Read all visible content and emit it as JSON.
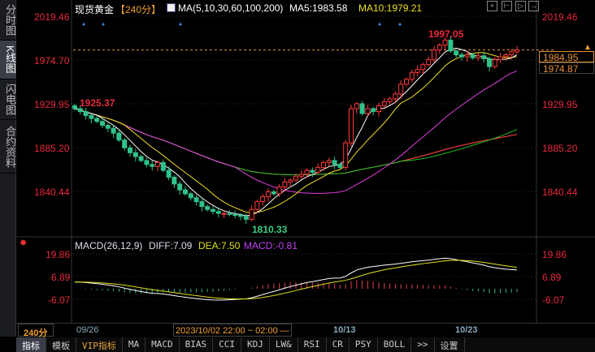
{
  "sidebar": {
    "items": [
      {
        "label": "分时图"
      },
      {
        "label": "K线图"
      },
      {
        "label": "闪电图"
      },
      {
        "label": "合约资料"
      }
    ]
  },
  "header": {
    "symbol": "现货黄金",
    "period": "【240分】",
    "ma_label": "MA(5,10,30,60,100,200)",
    "ma5": "MA5:1983.58",
    "ma10": "MA10:1979.21",
    "icon": "ma-chart-icon"
  },
  "toolbar_icons": [
    "crosshair-icon",
    "zoom-in-icon",
    "zoom-out-icon",
    "move-right-icon"
  ],
  "price_axis": {
    "left": [
      "2019.46",
      "1974.70",
      "1929.95",
      "1885.20",
      "1840.44"
    ],
    "right": [
      "2019.46",
      "1974.70",
      "1929.95",
      "1885.20",
      "1840.44"
    ]
  },
  "annotations": {
    "high": "1997.05",
    "start": "1925.37",
    "low": "1810.33"
  },
  "price_tags": {
    "last": "1984.95",
    "ma": "1974.87"
  },
  "macd": {
    "label": "MACD(26,12,9)",
    "diff": "DIFF:7.09",
    "dea": "DEA:7.50",
    "macd": "MACD:-0.81",
    "axis": [
      "19.86",
      "6.89",
      "-6.07"
    ]
  },
  "xaxis": {
    "period": "240分 ▲",
    "dates": [
      "09/26",
      "10/13",
      "10/23"
    ],
    "cursor": "2023/10/02 22:00 ~ 02:00 —"
  },
  "tabs": [
    "指标",
    "模板",
    "VIP指标",
    "MA",
    "MACD",
    "BIAS",
    "CCI",
    "KDJ",
    "LW&",
    "RSI",
    "CR",
    "PSY",
    "BOLL",
    ">>",
    "设置"
  ],
  "colors": {
    "up": "#ff3a3a",
    "down": "#2fc28a",
    "ma5": "#ffffff",
    "ma10": "#f0e020",
    "ma30": "#e040e0",
    "ma60": "#20c020",
    "ma100": "#ff3030",
    "ma200": "#9a9a9a"
  },
  "chart_data": {
    "type": "candlestick",
    "title": "现货黄金 240分",
    "ylim": [
      1810,
      2020
    ],
    "closes": [
      1925,
      1922,
      1918,
      1915,
      1912,
      1908,
      1905,
      1900,
      1893,
      1885,
      1880,
      1876,
      1872,
      1868,
      1866,
      1870,
      1862,
      1855,
      1848,
      1842,
      1838,
      1834,
      1830,
      1825,
      1822,
      1820,
      1818,
      1818,
      1817,
      1816,
      1815,
      1812,
      1822,
      1830,
      1835,
      1840,
      1838,
      1845,
      1850,
      1852,
      1856,
      1858,
      1862,
      1860,
      1865,
      1870,
      1872,
      1868,
      1865,
      1890,
      1925,
      1930,
      1920,
      1925,
      1922,
      1928,
      1932,
      1935,
      1940,
      1950,
      1955,
      1962,
      1965,
      1970,
      1975,
      1985,
      1990,
      1995,
      1984,
      1980,
      1978,
      1980,
      1977,
      1979,
      1976,
      1968,
      1975,
      1978,
      1980,
      1983,
      1985
    ],
    "high": 1997.05,
    "low": 1810.33,
    "start": 1925.37
  }
}
